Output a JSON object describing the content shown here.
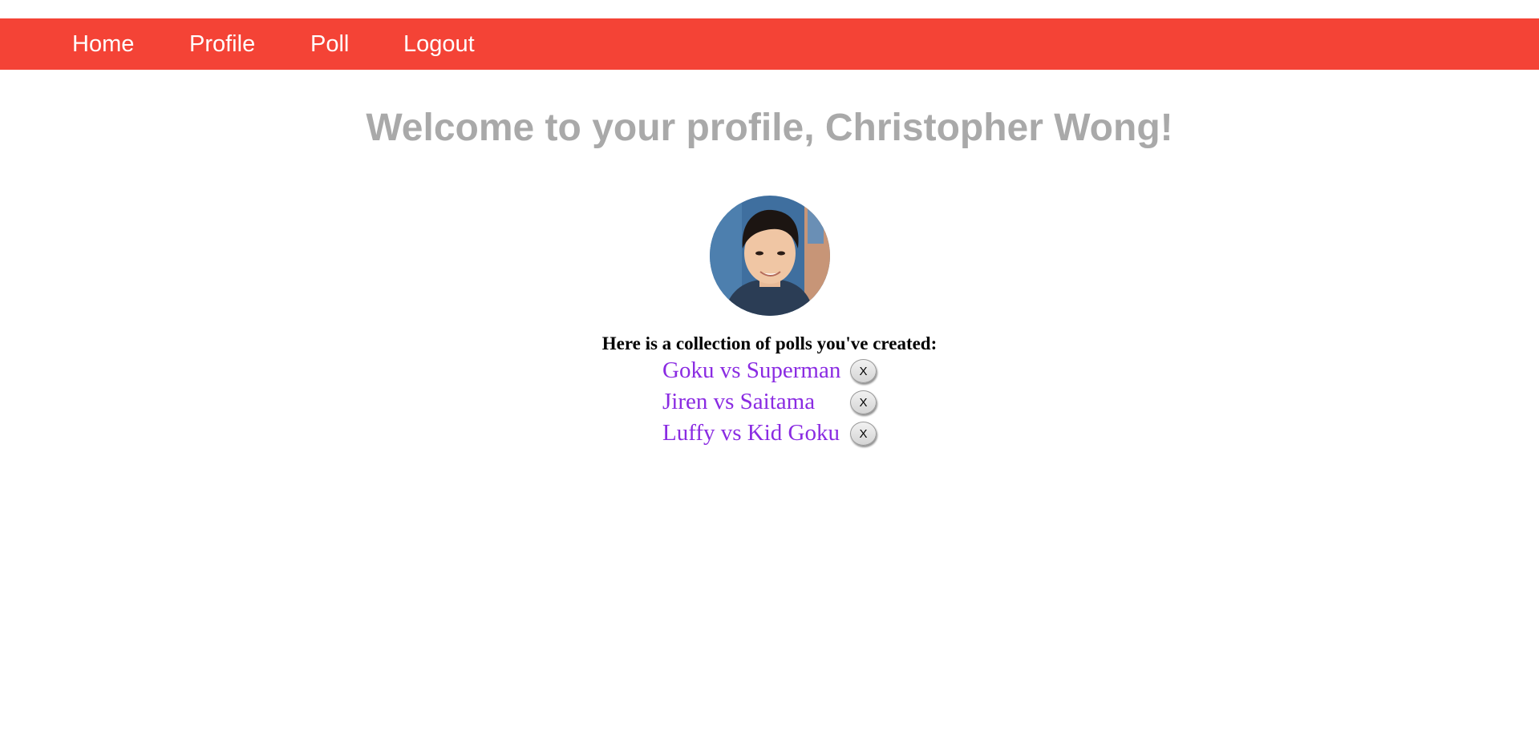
{
  "theme": {
    "navbar_color": "#f44336",
    "title_color": "#a9a9a9",
    "link_color": "#8a2be2"
  },
  "nav": {
    "items": [
      {
        "label": "Home"
      },
      {
        "label": "Profile"
      },
      {
        "label": "Poll"
      },
      {
        "label": "Logout"
      }
    ]
  },
  "profile": {
    "title": "Welcome to your profile, Christopher Wong!",
    "avatar_icon": "avatar-photo",
    "polls_intro": "Here is a collection of polls you've created:"
  },
  "polls": [
    {
      "title": "Goku vs Superman",
      "delete_label": "X"
    },
    {
      "title": "Jiren vs Saitama",
      "delete_label": "X"
    },
    {
      "title": "Luffy vs Kid Goku",
      "delete_label": "X"
    }
  ]
}
